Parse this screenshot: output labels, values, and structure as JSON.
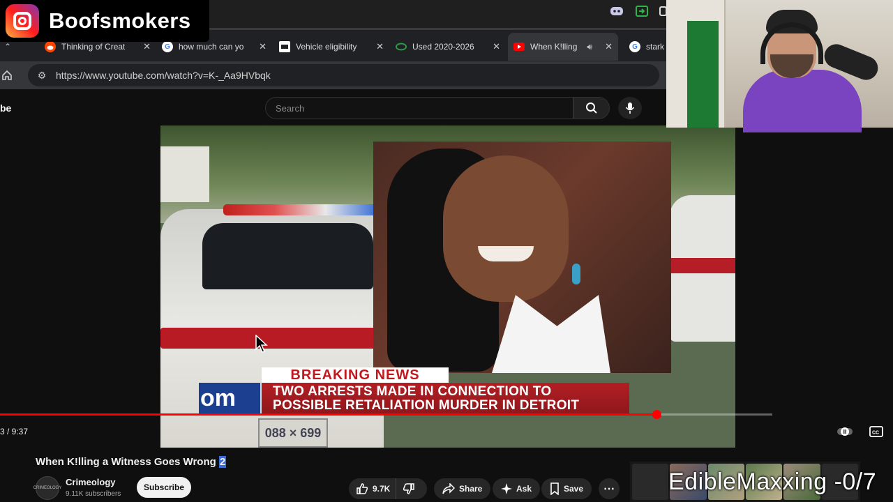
{
  "stream_overlay": {
    "instagram_handle": "Boofsmokers",
    "bottom_text": "EdibleMaxxing -0/7"
  },
  "browser": {
    "tabs": [
      {
        "title": "Thinking of Creat",
        "favicon": "reddit-icon",
        "color": "#ff4500",
        "active": false
      },
      {
        "title": "how much can yo",
        "favicon": "google-icon",
        "color": "#4285f4",
        "active": false
      },
      {
        "title": "Vehicle eligibility",
        "favicon": "document-icon",
        "color": "#ffffff",
        "active": false
      },
      {
        "title": "Used 2020-2026",
        "favicon": "car-site-icon",
        "color": "#2aa14a",
        "active": false
      },
      {
        "title": "When K!lling",
        "favicon": "youtube-icon",
        "color": "#ff0000",
        "active": true
      },
      {
        "title": "stark",
        "favicon": "google-icon",
        "color": "#4285f4",
        "active": false
      }
    ],
    "url": "https://www.youtube.com/watch?v=K-_Aa9HVbqk"
  },
  "youtube": {
    "logo_text": "be",
    "search_placeholder": "Search"
  },
  "video": {
    "news_breaking": "BREAKING NEWS",
    "news_brand": "om",
    "news_line1": "TWO ARRESTS MADE IN CONNECTION TO",
    "news_line2": "POSSIBLE RETALIATION MURDER IN DETROIT",
    "plate": "088 × 699",
    "progress_fraction": 0.85,
    "time": "3 / 9:37"
  },
  "meta": {
    "title_prefix": "When K!lling a Witness Goes Wrong ",
    "title_highlight": "2",
    "channel_name": "Crimeology",
    "channel_subs": "9.11K subscribers",
    "avatar_text": "CRIMEOLOGY",
    "subscribe_label": "Subscribe",
    "like_count": "9.7K",
    "share_label": "Share",
    "ask_label": "Ask",
    "save_label": "Save"
  },
  "colors": {
    "accent": "#ff0000",
    "breaking_red": "#c0181f",
    "brand_blue": "#1c3f8f",
    "highlight_blue": "#3b6bd9"
  }
}
